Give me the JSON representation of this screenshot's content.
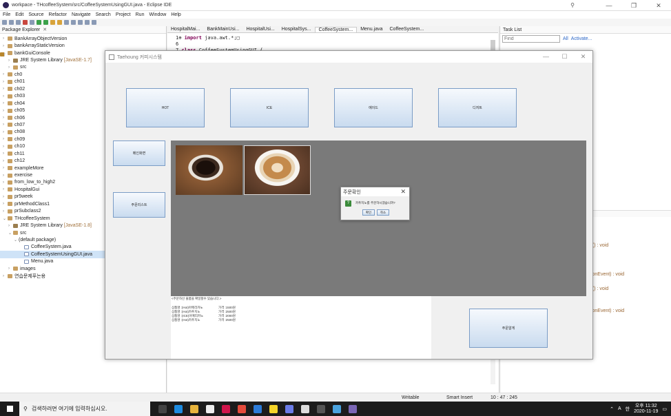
{
  "window": {
    "title": "workpace - THcoffeeSystem/src/CoffeeSystemUsingGUI.java - Eclipse IDE"
  },
  "menu": [
    "File",
    "Edit",
    "Source",
    "Refactor",
    "Navigate",
    "Search",
    "Project",
    "Run",
    "Window",
    "Help"
  ],
  "package_explorer": {
    "title": "Package Explorer",
    "items": [
      {
        "label": "BankArrayObjectVersion",
        "note": "",
        "depth": 0,
        "expanded": false
      },
      {
        "label": "bankArrayStaticVersion",
        "note": "",
        "depth": 0,
        "expanded": false
      },
      {
        "label": "bankGuiConsole",
        "note": "",
        "depth": 0,
        "expanded": true
      },
      {
        "label": "JRE System Library",
        "note": "[JavaSE-1.7]",
        "depth": 1,
        "expanded": false
      },
      {
        "label": "src",
        "note": "",
        "depth": 1,
        "expanded": false
      },
      {
        "label": "ch0",
        "note": "",
        "depth": 0,
        "expanded": false
      },
      {
        "label": "ch01",
        "note": "",
        "depth": 0,
        "expanded": false
      },
      {
        "label": "ch02",
        "note": "",
        "depth": 0,
        "expanded": false
      },
      {
        "label": "ch03",
        "note": "",
        "depth": 0,
        "expanded": false
      },
      {
        "label": "ch04",
        "note": "",
        "depth": 0,
        "expanded": false
      },
      {
        "label": "ch05",
        "note": "",
        "depth": 0,
        "expanded": false
      },
      {
        "label": "ch06",
        "note": "",
        "depth": 0,
        "expanded": false
      },
      {
        "label": "ch07",
        "note": "",
        "depth": 0,
        "expanded": false
      },
      {
        "label": "ch08",
        "note": "",
        "depth": 0,
        "expanded": false
      },
      {
        "label": "ch09",
        "note": "",
        "depth": 0,
        "expanded": false
      },
      {
        "label": "ch10",
        "note": "",
        "depth": 0,
        "expanded": false
      },
      {
        "label": "ch11",
        "note": "",
        "depth": 0,
        "expanded": false
      },
      {
        "label": "ch12",
        "note": "",
        "depth": 0,
        "expanded": false
      },
      {
        "label": "exampleMore",
        "note": "",
        "depth": 0,
        "expanded": false
      },
      {
        "label": "exercise",
        "note": "",
        "depth": 0,
        "expanded": false
      },
      {
        "label": "from_low_to_high2",
        "note": "",
        "depth": 0,
        "expanded": false
      },
      {
        "label": "HospitalGui",
        "note": "",
        "depth": 0,
        "expanded": false
      },
      {
        "label": "pr5week",
        "note": "",
        "depth": 0,
        "expanded": false
      },
      {
        "label": "prMethodClass1",
        "note": "",
        "depth": 0,
        "expanded": false
      },
      {
        "label": "prSubclass2",
        "note": "",
        "depth": 0,
        "expanded": false
      },
      {
        "label": "THcoffeeSystem",
        "note": "",
        "depth": 0,
        "expanded": true
      },
      {
        "label": "JRE System Library",
        "note": "[JavaSE-1.8]",
        "depth": 1,
        "expanded": false
      },
      {
        "label": "src",
        "note": "",
        "depth": 1,
        "expanded": true
      },
      {
        "label": "(default package)",
        "note": "",
        "depth": 2,
        "expanded": true
      },
      {
        "label": "CoffeeSystem.java",
        "note": "",
        "depth": 3,
        "expanded": false
      },
      {
        "label": "CoffeeSystemUsingGUI.java",
        "note": "",
        "depth": 3,
        "expanded": false,
        "selected": true
      },
      {
        "label": "Menu.java",
        "note": "",
        "depth": 3,
        "expanded": false
      },
      {
        "label": "images",
        "note": "",
        "depth": 1,
        "expanded": false
      },
      {
        "label": "연습문제푸는용",
        "note": "",
        "depth": 0,
        "expanded": false
      }
    ]
  },
  "editor": {
    "tabs": [
      "HospitalMai...",
      "BankMainUsi...",
      "HospitalUsi...",
      "HospitalSys...",
      "CoffeeSystem...",
      "Menu.java",
      "CoffeeSystem..."
    ],
    "active_tab": 4,
    "lines": [
      {
        "num": "1",
        "marker": "⊕",
        "text": "java.awt.*;□",
        "kw": "import"
      },
      {
        "num": "6",
        "marker": "",
        "text": "",
        "kw": ""
      },
      {
        "num": "7",
        "marker": "",
        "text": "CoffeeSystemUsingGUI {",
        "kw": "class"
      }
    ]
  },
  "tasks": {
    "title": "Task List",
    "find_placeholder": "Find",
    "all": "All",
    "activate": "Activate..."
  },
  "outline_fragments": [
    "d() : void",
    "tionEvent) : void",
    "d() : void",
    "tionEvent) : void"
  ],
  "status": {
    "writable": "Writable",
    "insert": "Smart Insert",
    "position": "10 : 47 : 245"
  },
  "taskbar": {
    "search": "검색하려면 여기에 입력하십시오.",
    "time": "오후 11:32",
    "date": "2020-11-19",
    "ime": "A",
    "ime2": "한"
  },
  "swing": {
    "title": "Taehoung 커피시스템",
    "category_buttons": [
      "HOT",
      "ICE",
      "에이드",
      "디저트"
    ],
    "side_buttons": [
      "메인화면",
      "주문리스트"
    ],
    "order_button": "주문알게",
    "receipt_header": "<주문하신 물품을 확일할수 있습니다.>",
    "receipt_lines": [
      {
        "name": "상품명 :(Hot)아메리카노",
        "price": "가격 :1500원"
      },
      {
        "name": "상품명 :(Hot)카푸치노",
        "price": "가격 :2500원"
      },
      {
        "name": "상품명 :(ICE)아메리카노",
        "price": "가격 :2000원"
      },
      {
        "name": "상품명 :(Hot)카푸치노",
        "price": "가격 :2500원"
      }
    ]
  },
  "confirm": {
    "title": "주문확인",
    "message": "카푸치노를 주문하시겠습니까?",
    "yes": "확인",
    "no": "취소",
    "icon": "?"
  }
}
